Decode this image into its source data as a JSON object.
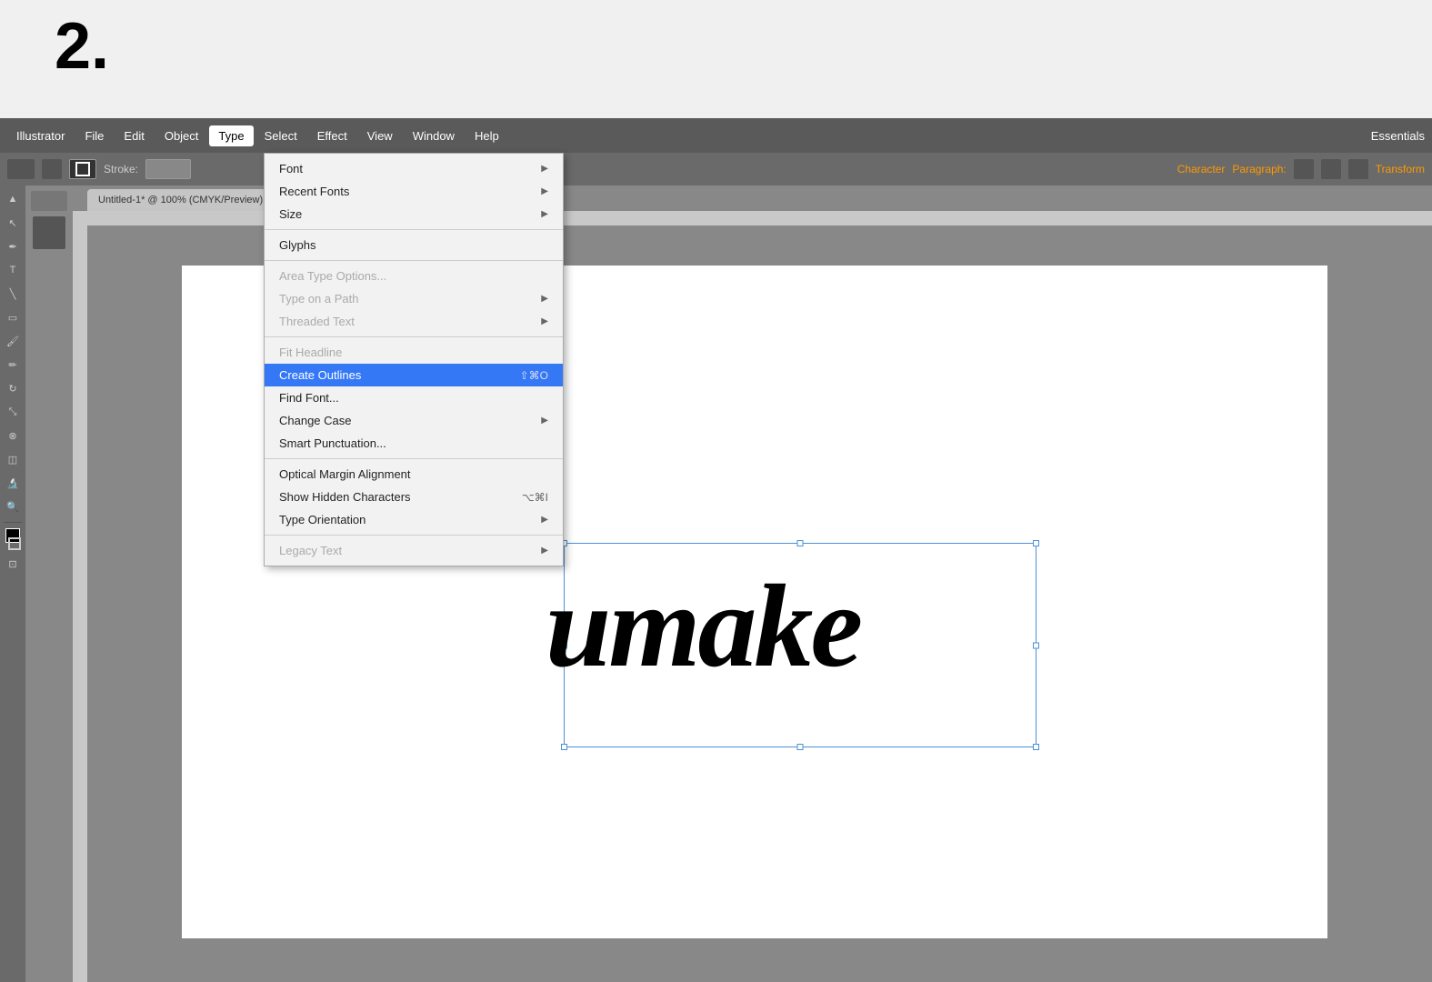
{
  "step": {
    "number": "2."
  },
  "menubar": {
    "items": [
      {
        "label": "Illustrator",
        "id": "illustrator",
        "active": false
      },
      {
        "label": "File",
        "id": "file",
        "active": false
      },
      {
        "label": "Edit",
        "id": "edit",
        "active": false
      },
      {
        "label": "Object",
        "id": "object",
        "active": false
      },
      {
        "label": "Type",
        "id": "type",
        "active": true
      },
      {
        "label": "Select",
        "id": "select",
        "active": false
      },
      {
        "label": "Effect",
        "id": "effect",
        "active": false
      },
      {
        "label": "View",
        "id": "view",
        "active": false
      },
      {
        "label": "Window",
        "id": "window",
        "active": false
      },
      {
        "label": "Help",
        "id": "help",
        "active": false
      }
    ],
    "right": {
      "essentials": "Essentials"
    }
  },
  "tab": {
    "label": "Untitled-1* @ 100% (CMYK/Preview)"
  },
  "dropdown": {
    "items": [
      {
        "label": "Font",
        "shortcut": "",
        "arrow": "▶",
        "disabled": false,
        "highlighted": false,
        "id": "font"
      },
      {
        "label": "Recent Fonts",
        "shortcut": "",
        "arrow": "▶",
        "disabled": false,
        "highlighted": false,
        "id": "recent-fonts"
      },
      {
        "label": "Size",
        "shortcut": "",
        "arrow": "▶",
        "disabled": false,
        "highlighted": false,
        "id": "size"
      },
      {
        "label": "separator1"
      },
      {
        "label": "Glyphs",
        "shortcut": "",
        "arrow": "",
        "disabled": false,
        "highlighted": false,
        "id": "glyphs"
      },
      {
        "label": "separator2"
      },
      {
        "label": "Area Type Options...",
        "shortcut": "",
        "arrow": "",
        "disabled": true,
        "highlighted": false,
        "id": "area-type-options"
      },
      {
        "label": "Type on a Path",
        "shortcut": "",
        "arrow": "▶",
        "disabled": true,
        "highlighted": false,
        "id": "type-on-path"
      },
      {
        "label": "Threaded Text",
        "shortcut": "",
        "arrow": "▶",
        "disabled": true,
        "highlighted": false,
        "id": "threaded-text"
      },
      {
        "label": "separator3"
      },
      {
        "label": "Fit Headline",
        "shortcut": "",
        "arrow": "",
        "disabled": true,
        "highlighted": false,
        "id": "fit-headline"
      },
      {
        "label": "Create Outlines",
        "shortcut": "⇧⌘O",
        "arrow": "",
        "disabled": false,
        "highlighted": true,
        "id": "create-outlines"
      },
      {
        "label": "Find Font...",
        "shortcut": "",
        "arrow": "",
        "disabled": false,
        "highlighted": false,
        "id": "find-font"
      },
      {
        "label": "Change Case",
        "shortcut": "",
        "arrow": "▶",
        "disabled": false,
        "highlighted": false,
        "id": "change-case"
      },
      {
        "label": "Smart Punctuation...",
        "shortcut": "",
        "arrow": "",
        "disabled": false,
        "highlighted": false,
        "id": "smart-punctuation"
      },
      {
        "label": "separator4"
      },
      {
        "label": "Optical Margin Alignment",
        "shortcut": "",
        "arrow": "",
        "disabled": false,
        "highlighted": false,
        "id": "optical-margin"
      },
      {
        "label": "Show Hidden Characters",
        "shortcut": "⌥⌘I",
        "arrow": "",
        "disabled": false,
        "highlighted": false,
        "id": "show-hidden"
      },
      {
        "label": "Type Orientation",
        "shortcut": "",
        "arrow": "▶",
        "disabled": false,
        "highlighted": false,
        "id": "type-orientation"
      },
      {
        "label": "separator5"
      },
      {
        "label": "Legacy Text",
        "shortcut": "",
        "arrow": "▶",
        "disabled": true,
        "highlighted": false,
        "id": "legacy-text"
      }
    ]
  },
  "canvas": {
    "text": "umake"
  },
  "colors": {
    "highlight_bg": "#3478f6",
    "menubar_bg": "#5a5a5a",
    "canvas_bg": "#888888",
    "white": "#ffffff"
  }
}
